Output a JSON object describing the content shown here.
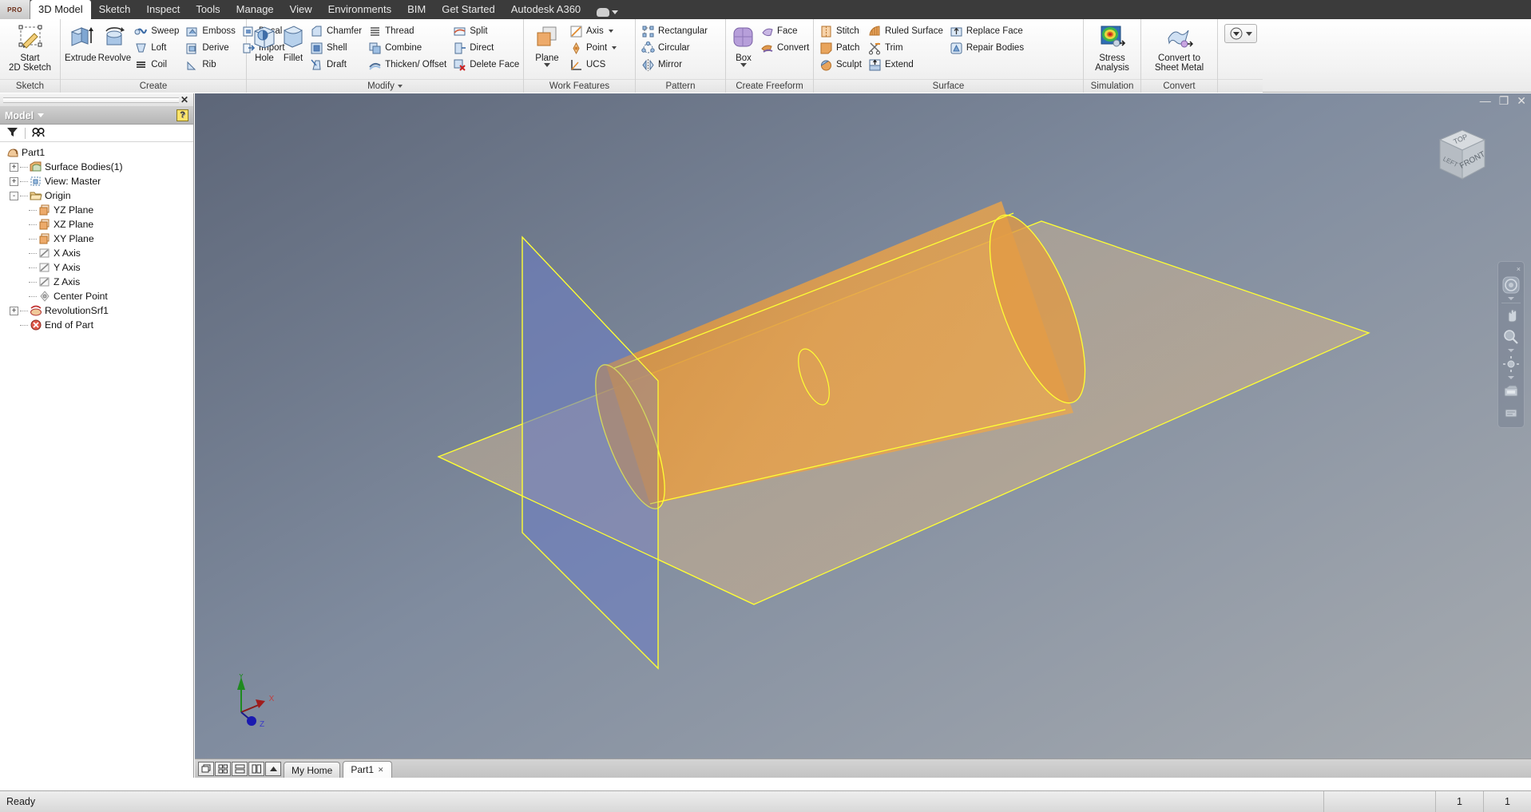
{
  "window": {
    "app_badge": "PRO",
    "minimize": "—",
    "restore": "❐",
    "close": "✕"
  },
  "menubar": {
    "items": [
      {
        "label": "3D Model",
        "active": true
      },
      {
        "label": "Sketch",
        "active": false
      },
      {
        "label": "Inspect",
        "active": false
      },
      {
        "label": "Tools",
        "active": false
      },
      {
        "label": "Manage",
        "active": false
      },
      {
        "label": "View",
        "active": false
      },
      {
        "label": "Environments",
        "active": false
      },
      {
        "label": "BIM",
        "active": false
      },
      {
        "label": "Get Started",
        "active": false
      },
      {
        "label": "Autodesk A360",
        "active": false
      }
    ]
  },
  "ribbon": {
    "panels": [
      {
        "name": "Sketch",
        "label": "Sketch",
        "has_caret": false,
        "big_buttons": [
          {
            "label": "Start\n2D Sketch",
            "icon": "start-2d-sketch-icon",
            "dropdown": true
          }
        ],
        "columns": []
      },
      {
        "name": "Create",
        "label": "Create",
        "has_caret": false,
        "big_buttons": [
          {
            "label": "Extrude",
            "icon": "extrude-icon",
            "dropdown": false
          },
          {
            "label": "Revolve",
            "icon": "revolve-icon",
            "dropdown": false
          }
        ],
        "columns": [
          [
            {
              "label": "Sweep",
              "icon": "sweep-icon"
            },
            {
              "label": "Loft",
              "icon": "loft-icon"
            },
            {
              "label": "Coil",
              "icon": "coil-icon"
            }
          ],
          [
            {
              "label": "Emboss",
              "icon": "emboss-icon"
            },
            {
              "label": "Derive",
              "icon": "derive-icon"
            },
            {
              "label": "Rib",
              "icon": "rib-icon"
            }
          ],
          [
            {
              "label": "Decal",
              "icon": "decal-icon"
            },
            {
              "label": "Import",
              "icon": "import-icon"
            }
          ]
        ]
      },
      {
        "name": "Modify",
        "label": "Modify",
        "has_caret": true,
        "big_buttons": [
          {
            "label": "Hole",
            "icon": "hole-icon",
            "dropdown": false
          },
          {
            "label": "Fillet",
            "icon": "fillet-icon",
            "dropdown": false
          }
        ],
        "columns": [
          [
            {
              "label": "Chamfer",
              "icon": "chamfer-icon"
            },
            {
              "label": "Shell",
              "icon": "shell-icon"
            },
            {
              "label": "Draft",
              "icon": "draft-icon"
            }
          ],
          [
            {
              "label": "Thread",
              "icon": "thread-icon"
            },
            {
              "label": "Combine",
              "icon": "combine-icon"
            },
            {
              "label": "Thicken/ Offset",
              "icon": "thicken-offset-icon"
            }
          ],
          [
            {
              "label": "Split",
              "icon": "split-icon"
            },
            {
              "label": "Direct",
              "icon": "direct-icon"
            },
            {
              "label": "Delete Face",
              "icon": "delete-face-icon"
            }
          ]
        ]
      },
      {
        "name": "Work Features",
        "label": "Work Features",
        "has_caret": false,
        "big_buttons": [
          {
            "label": "Plane",
            "icon": "plane-icon",
            "dropdown": true
          }
        ],
        "columns": [
          [
            {
              "label": "Axis",
              "icon": "axis-icon",
              "caret": true
            },
            {
              "label": "Point",
              "icon": "point-icon",
              "caret": true
            },
            {
              "label": "UCS",
              "icon": "ucs-icon"
            }
          ]
        ]
      },
      {
        "name": "Pattern",
        "label": "Pattern",
        "has_caret": false,
        "big_buttons": [],
        "columns": [
          [
            {
              "label": "Rectangular",
              "icon": "rectangular-pattern-icon"
            },
            {
              "label": "Circular",
              "icon": "circular-pattern-icon"
            },
            {
              "label": "Mirror",
              "icon": "mirror-icon"
            }
          ]
        ]
      },
      {
        "name": "Create Freeform",
        "label": "Create Freeform",
        "has_caret": false,
        "big_buttons": [
          {
            "label": "Box",
            "icon": "freeform-box-icon",
            "dropdown": true
          }
        ],
        "columns": [
          [
            {
              "label": "Face",
              "icon": "freeform-face-icon"
            },
            {
              "label": "Convert",
              "icon": "freeform-convert-icon"
            }
          ]
        ]
      },
      {
        "name": "Surface",
        "label": "Surface",
        "has_caret": false,
        "big_buttons": [],
        "columns": [
          [
            {
              "label": "Stitch",
              "icon": "stitch-icon"
            },
            {
              "label": "Patch",
              "icon": "patch-icon"
            },
            {
              "label": "Sculpt",
              "icon": "sculpt-icon"
            }
          ],
          [
            {
              "label": "Ruled Surface",
              "icon": "ruled-surface-icon"
            },
            {
              "label": "Trim",
              "icon": "trim-icon"
            },
            {
              "label": "Extend",
              "icon": "extend-icon"
            }
          ],
          [
            {
              "label": "Replace Face",
              "icon": "replace-face-icon"
            },
            {
              "label": "Repair Bodies",
              "icon": "repair-bodies-icon"
            }
          ]
        ]
      },
      {
        "name": "Simulation",
        "label": "Simulation",
        "has_caret": false,
        "big_buttons": [
          {
            "label": "Stress\nAnalysis",
            "icon": "stress-analysis-icon",
            "dropdown": false
          }
        ],
        "columns": []
      },
      {
        "name": "Convert",
        "label": "Convert",
        "has_caret": false,
        "big_buttons": [
          {
            "label": "Convert to\nSheet Metal",
            "icon": "convert-sheet-metal-icon",
            "dropdown": false
          }
        ],
        "columns": []
      }
    ],
    "overflow_button": "appearance-dropdown"
  },
  "browser": {
    "title": "Model",
    "help_glyph": "?",
    "close_glyph": "✕",
    "tools": [
      {
        "name": "filter-icon",
        "label": ""
      },
      {
        "name": "find-icon",
        "label": ""
      }
    ],
    "tree": [
      {
        "label": "Part1",
        "depth": 0,
        "expander": "",
        "icon": "part-icon"
      },
      {
        "label": "Surface Bodies(1)",
        "depth": 1,
        "expander": "+",
        "icon": "surface-bodies-icon"
      },
      {
        "label": "View: Master",
        "depth": 1,
        "expander": "+",
        "icon": "view-master-icon"
      },
      {
        "label": "Origin",
        "depth": 1,
        "expander": "-",
        "icon": "origin-folder-icon"
      },
      {
        "label": "YZ Plane",
        "depth": 2,
        "expander": "",
        "icon": "plane-node-icon"
      },
      {
        "label": "XZ Plane",
        "depth": 2,
        "expander": "",
        "icon": "plane-node-icon"
      },
      {
        "label": "XY Plane",
        "depth": 2,
        "expander": "",
        "icon": "plane-node-icon"
      },
      {
        "label": "X Axis",
        "depth": 2,
        "expander": "",
        "icon": "axis-node-icon"
      },
      {
        "label": "Y Axis",
        "depth": 2,
        "expander": "",
        "icon": "axis-node-icon"
      },
      {
        "label": "Z Axis",
        "depth": 2,
        "expander": "",
        "icon": "axis-node-icon"
      },
      {
        "label": "Center Point",
        "depth": 2,
        "expander": "",
        "icon": "center-point-icon"
      },
      {
        "label": "RevolutionSrf1",
        "depth": 1,
        "expander": "+",
        "icon": "revolution-srf-icon"
      },
      {
        "label": "End of Part",
        "depth": 1,
        "expander": "",
        "icon": "end-of-part-icon"
      }
    ]
  },
  "viewport": {
    "viewcube": {
      "top": "TOP",
      "front": "FRONT",
      "left": "LEFT"
    },
    "navbar": {
      "close": "×",
      "items": [
        {
          "name": "steering-wheel-icon"
        },
        {
          "name": "pan-icon"
        },
        {
          "name": "zoom-icon"
        },
        {
          "name": "orbit-icon"
        },
        {
          "name": "look-at-icon"
        },
        {
          "name": "display-settings-icon"
        }
      ]
    },
    "axis_triad": {
      "x": "X",
      "y": "Y",
      "z": "Z"
    },
    "model": {
      "description": "Transparent orange revolved surface (tapered cone/tube) with yellow edge curves, intersected by translucent work planes",
      "surface_color": "#e39a3e",
      "edge_color": "#ffff33",
      "plane_color": "#6d7fc0"
    }
  },
  "docbar": {
    "view_buttons": [
      {
        "name": "cascade-windows-button"
      },
      {
        "name": "tile-windows-button"
      },
      {
        "name": "tile-horizontal-button"
      },
      {
        "name": "tile-vertical-button"
      },
      {
        "name": "scroll-tabs-up-button"
      }
    ],
    "tabs": [
      {
        "label": "My Home",
        "active": false,
        "closable": false
      },
      {
        "label": "Part1",
        "active": true,
        "closable": true,
        "close_glyph": "✕"
      }
    ]
  },
  "statusbar": {
    "message": "Ready",
    "cells": [
      "",
      "1",
      "1"
    ]
  }
}
